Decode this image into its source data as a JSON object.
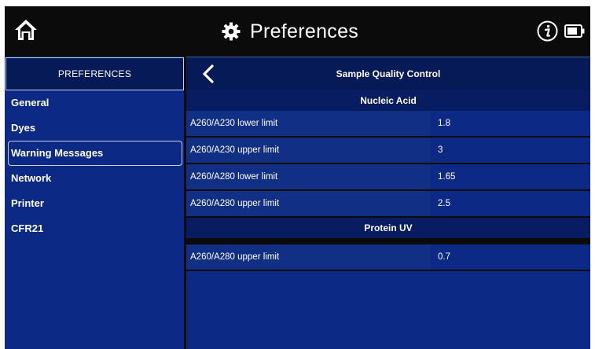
{
  "header": {
    "title": "Preferences",
    "icons": {
      "home": "home-icon",
      "settings": "gear-icon",
      "info": "info-icon",
      "battery": "battery-icon"
    }
  },
  "sidebar": {
    "title": "PREFERENCES",
    "items": [
      {
        "label": "General",
        "selected": false
      },
      {
        "label": "Dyes",
        "selected": false
      },
      {
        "label": "Warning Messages",
        "selected": true
      },
      {
        "label": "Network",
        "selected": false
      },
      {
        "label": "Printer",
        "selected": false
      },
      {
        "label": "CFR21",
        "selected": false
      }
    ]
  },
  "main": {
    "title": "Sample Quality Control",
    "back_icon": "chevron-left-icon",
    "sections": [
      {
        "title": "Nucleic Acid",
        "rows": [
          {
            "label": "A260/A230 lower limit",
            "value": "1.8"
          },
          {
            "label": "A260/A230 upper limit",
            "value": "3"
          },
          {
            "label": "A260/A280 lower limit",
            "value": "1.65"
          },
          {
            "label": "A260/A280 upper limit",
            "value": "2.5"
          }
        ]
      },
      {
        "title": "Protein UV",
        "rows": [
          {
            "label": "A260/A280 upper limit",
            "value": "0.7"
          }
        ]
      }
    ]
  },
  "colors": {
    "panel": "#0c2a85",
    "panel_dark": "#061a58",
    "background": "#0b0b0b"
  }
}
